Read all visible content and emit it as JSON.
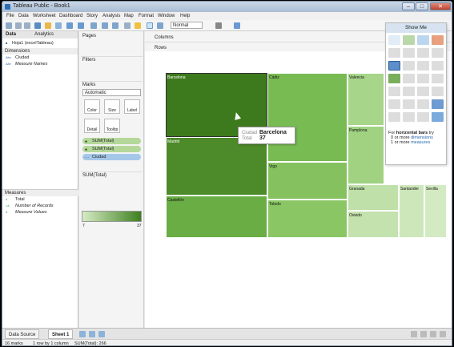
{
  "window": {
    "title": "Tableau Public - Book1",
    "min": "–",
    "max": "□",
    "close": "✕"
  },
  "menu": [
    "File",
    "Data",
    "Worksheet",
    "Dashboard",
    "Story",
    "Analysis",
    "Map",
    "Format",
    "Window",
    "Help"
  ],
  "toolbar": {
    "fit_dropdown": "Normal"
  },
  "left_panel": {
    "tabs": [
      "Data",
      "Analytics"
    ],
    "datasource": "Hoja1 (excelTableau)",
    "dimensions_label": "Dimensions",
    "dimensions": [
      {
        "type": "Abc",
        "name": "Ciudad"
      },
      {
        "type": "Abc",
        "name": "Measure Names"
      }
    ],
    "measures_label": "Measures",
    "measures": [
      {
        "type": "#",
        "name": "Total"
      },
      {
        "type": "=#",
        "name": "Number of Records"
      },
      {
        "type": "#",
        "name": "Measure Values"
      }
    ]
  },
  "cards": {
    "pages": "Pages",
    "filters": "Filters",
    "marks": "Marks",
    "mark_type": "Automatic",
    "buttons": [
      "Color",
      "Size",
      "Label",
      "Detail",
      "Tooltip"
    ],
    "pills": [
      "SUM(Total)",
      "SUM(Total)",
      "Ciudad"
    ],
    "legend_title": "SUM(Total)",
    "legend_min": "7",
    "legend_max": "37"
  },
  "shelves": {
    "columns": "Columns",
    "rows": "Rows"
  },
  "treemap": {
    "tiles": [
      "Barcelona",
      "Madrid",
      "Castellón",
      "Cádiz",
      "Vigo",
      "Toledo",
      "Valencia",
      "Pamplona",
      "Granada",
      "Oviedo",
      "Santander",
      "Sevilla"
    ],
    "tooltip": {
      "key1": "Ciudad",
      "val1": "Barcelona",
      "key2": "Total",
      "val2": "37"
    }
  },
  "showme": {
    "title": "Show Me",
    "hint_pre": "For ",
    "hint_bold": "horizontal bars",
    "hint_post": " try",
    "line2_pre": "0 or more ",
    "line2_link": "dimensions",
    "line3_pre": "1 or more ",
    "line3_link": "measures"
  },
  "bottom": {
    "data_source": "Data Source",
    "sheet": "Sheet 1"
  },
  "status": {
    "marks": "16 marks",
    "rows": "1 row by 1 column",
    "sum": "SUM(Total): 266"
  }
}
